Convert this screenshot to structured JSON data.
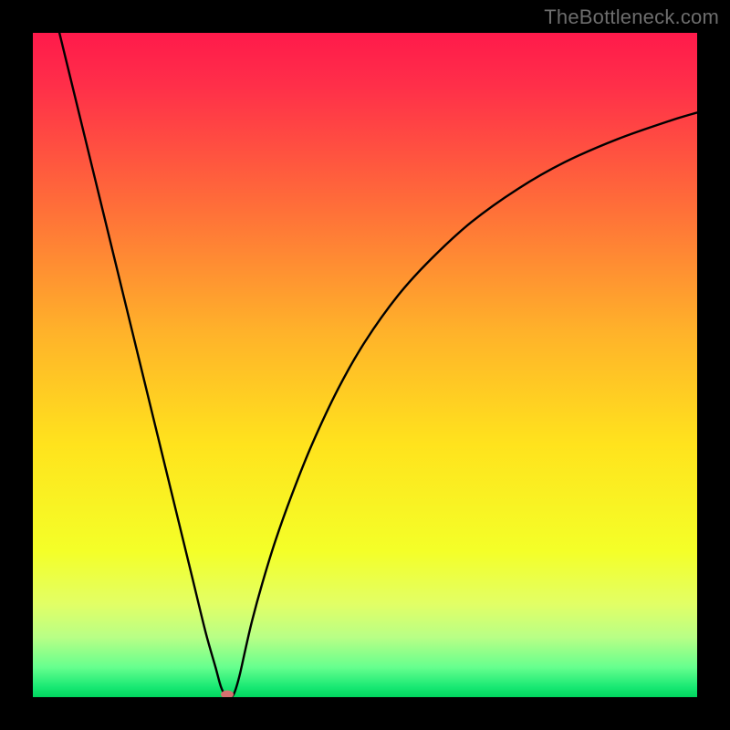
{
  "watermark": {
    "text": "TheBottleneck.com"
  },
  "chart_data": {
    "type": "line",
    "title": "",
    "xlabel": "",
    "ylabel": "",
    "xlim": [
      0,
      100
    ],
    "ylim": [
      0,
      100
    ],
    "gradient_stops": [
      {
        "offset": 0,
        "color": "#ff1a4b"
      },
      {
        "offset": 0.08,
        "color": "#ff2f49"
      },
      {
        "offset": 0.25,
        "color": "#ff6a3a"
      },
      {
        "offset": 0.45,
        "color": "#ffb22a"
      },
      {
        "offset": 0.62,
        "color": "#ffe31d"
      },
      {
        "offset": 0.78,
        "color": "#f4ff28"
      },
      {
        "offset": 0.86,
        "color": "#e2ff66"
      },
      {
        "offset": 0.91,
        "color": "#b8ff86"
      },
      {
        "offset": 0.955,
        "color": "#66ff8e"
      },
      {
        "offset": 0.985,
        "color": "#18e873"
      },
      {
        "offset": 1.0,
        "color": "#00d55e"
      }
    ],
    "series": [
      {
        "name": "bottleneck-curve",
        "color": "#000000",
        "x": [
          4.0,
          6,
          8,
          10,
          12,
          14,
          16,
          18,
          20,
          22,
          24,
          26,
          27.5,
          28.3,
          29,
          29.6,
          30.15,
          30.6,
          31.2,
          32,
          33,
          34.5,
          36.5,
          39,
          42,
          46,
          50,
          55,
          60,
          66,
          73,
          80,
          88,
          96,
          100
        ],
        "values": [
          100,
          91.8,
          83.6,
          75.4,
          67.2,
          59.0,
          50.8,
          42.6,
          34.4,
          26.2,
          18.0,
          9.8,
          4.5,
          1.6,
          0.25,
          0.0,
          0.3,
          1.4,
          3.6,
          7.2,
          11.5,
          17.0,
          23.5,
          30.5,
          38.0,
          46.5,
          53.5,
          60.5,
          66.0,
          71.5,
          76.5,
          80.5,
          84.0,
          86.8,
          88.0
        ]
      }
    ],
    "marker": {
      "x": 29.3,
      "y": 0.4,
      "color": "#d6706f"
    }
  }
}
